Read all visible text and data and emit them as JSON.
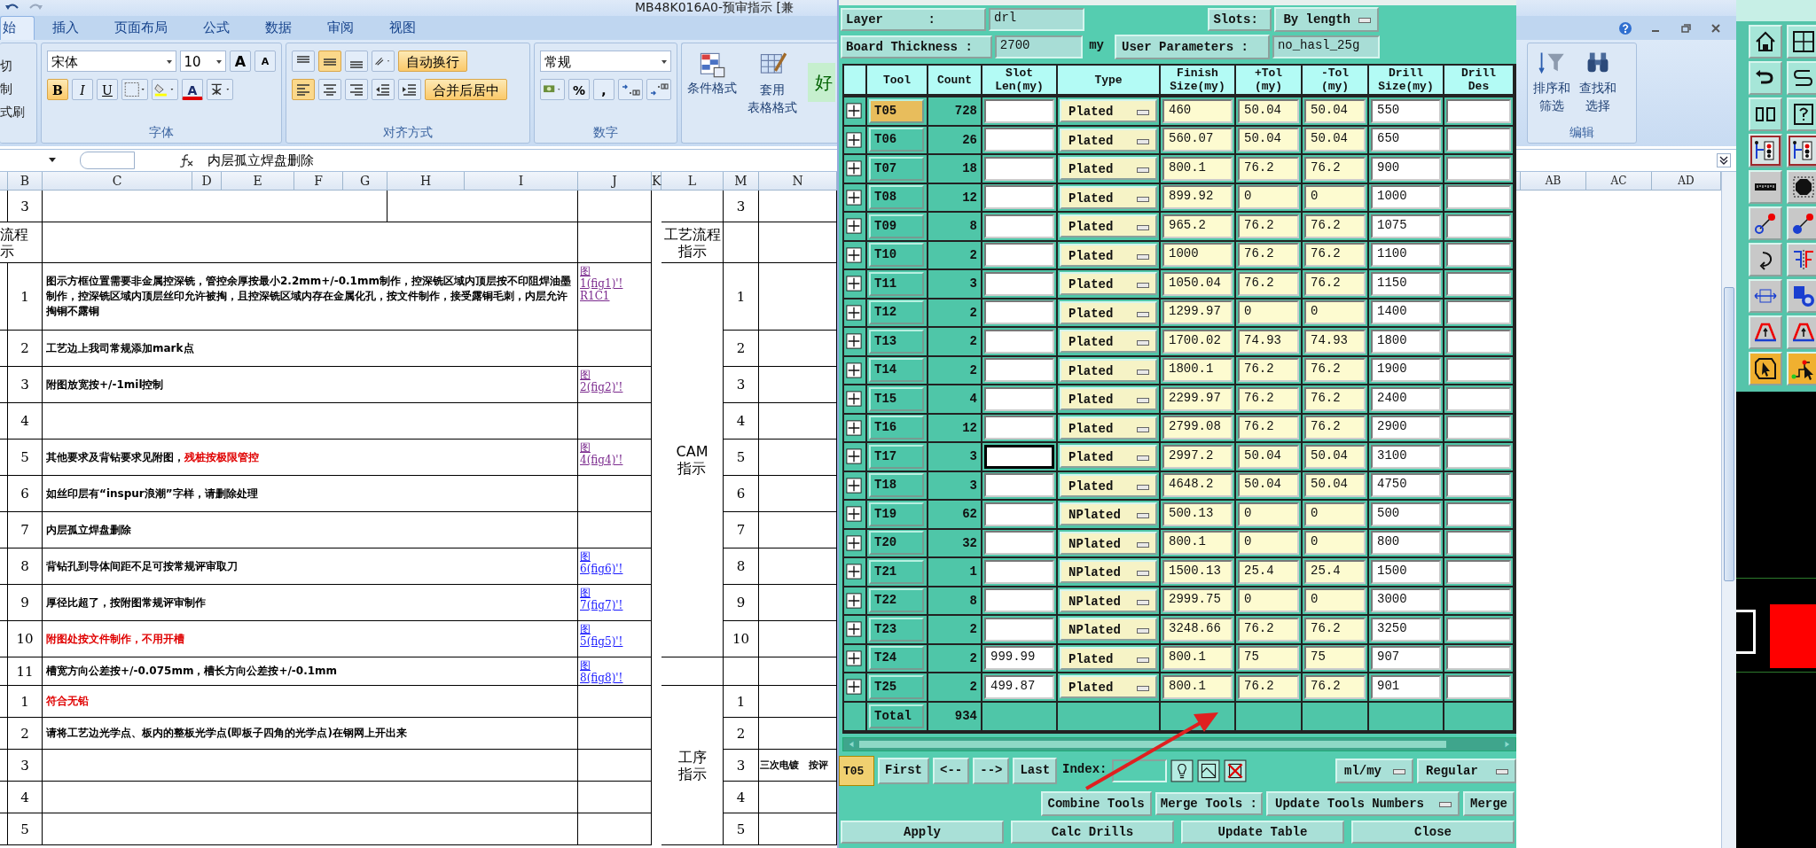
{
  "excel": {
    "title": "MB48K016A0-预审指示 [兼",
    "tabs": [
      {
        "label": "始",
        "selected": true
      },
      {
        "label": "插入",
        "selected": false
      },
      {
        "label": "页面布局",
        "selected": false
      },
      {
        "label": "公式",
        "selected": false
      },
      {
        "label": "数据",
        "selected": false
      },
      {
        "label": "审阅",
        "selected": false
      },
      {
        "label": "视图",
        "selected": false
      }
    ],
    "clipboard": [
      "切",
      "制",
      "式刷"
    ],
    "font_group": {
      "font": "宋体",
      "size": "10",
      "grow": "A",
      "shrink": "A",
      "bold": "B",
      "italic": "I",
      "underline": "U",
      "font_color_letter": "A",
      "label": "字体"
    },
    "align_group": {
      "wrap": "自动换行",
      "merge": "合并后居中",
      "label": "对齐方式"
    },
    "number_group": {
      "format": "常规",
      "percent": "%",
      "comma": ",",
      "label": "数字"
    },
    "styles_group": {
      "conditional": "条件格式",
      "table_style": [
        "套用",
        "表格格式"
      ],
      "good": "好"
    },
    "editing_group": {
      "sort": [
        "排序和",
        "筛选"
      ],
      "find": [
        "查找和",
        "选择"
      ],
      "label": "编辑"
    },
    "formula": "内层孤立焊盘删除",
    "columns": [
      "B",
      "C",
      "D",
      "E",
      "F",
      "G",
      "H",
      "I",
      "J",
      "K",
      "L",
      "M",
      "N"
    ],
    "far_columns": [
      "AB",
      "AC",
      "AD"
    ]
  },
  "sheet": {
    "top": {
      "b": "3",
      "m": "3"
    },
    "head": {
      "b": [
        "流程",
        "示"
      ],
      "l": [
        "工艺流程",
        "指示"
      ]
    },
    "groups": [
      {
        "label": [
          "CAM",
          "指示"
        ],
        "rows": [
          {
            "no": "1",
            "parts": [
              {
                "text": "图示方框位置需要非金属控深铣，管控余厚按最小2.2mm+/-0.1mm制作，控深铣区域内顶层按不印阻焊油墨制作，控深铣区域内顶层丝印允许被掏，且控深铣区域内存在金属化孔，按文件制作，接受露铜毛刺，内层允许掏铜不露铜",
                "alert": false
              }
            ],
            "link": {
              "text": "图\n1(fig1)'!\nR1C1",
              "visited": true
            },
            "m": "1"
          },
          {
            "no": "2",
            "parts": [
              {
                "text": "工艺边上我司常规添加mark点",
                "alert": false
              }
            ],
            "m": "2"
          },
          {
            "no": "3",
            "parts": [
              {
                "text": "附图放宽按+/-1mil控制",
                "alert": false
              }
            ],
            "link": {
              "text": "图\n2(fig2)'!",
              "visited": true
            },
            "m": "3"
          },
          {
            "no": "4",
            "m": "4"
          },
          {
            "no": "5",
            "parts": [
              {
                "text": "其他要求及背钻要求见附图，",
                "alert": false
              },
              {
                "text": "残桩按极限管控",
                "alert": true
              }
            ],
            "link": {
              "text": "图\n4(fig4)'!",
              "visited": true
            },
            "m": "5"
          },
          {
            "no": "6",
            "parts": [
              {
                "text": "如丝印层有“inspur浪潮”字样，请删除处理",
                "alert": false
              }
            ],
            "m": "6"
          },
          {
            "no": "7",
            "parts": [
              {
                "text": "内层孤立焊盘删除",
                "alert": false
              }
            ],
            "m": "7"
          },
          {
            "no": "8",
            "parts": [
              {
                "text": "背钻孔到导体间距不足可按常规评审取刀",
                "alert": false
              }
            ],
            "link": {
              "text": "图\n6(fig6)'!",
              "visited": false
            },
            "m": "8"
          },
          {
            "no": "9",
            "parts": [
              {
                "text": "厚径比超了，按附图常规评审制作",
                "alert": false
              }
            ],
            "link": {
              "text": "图\n7(fig7)'!",
              "visited": false
            },
            "m": "9"
          },
          {
            "no": "10",
            "parts": [
              {
                "text": "附图处按文件制作，不用开槽",
                "alert": true
              }
            ],
            "link": {
              "text": "图\n5(fig5)'!",
              "visited": false
            },
            "m": "10"
          }
        ]
      },
      {
        "rows": [
          {
            "no": "11",
            "parts": [
              {
                "text": "槽宽方向公差按+/-0.075mm，槽长方向公差按+/-0.1mm",
                "alert": false
              }
            ],
            "link": {
              "text": "图\n8(fig8)'!",
              "visited": false
            }
          }
        ]
      },
      {
        "label": [
          "工序",
          "指示"
        ],
        "rows": [
          {
            "no": "1",
            "parts": [
              {
                "text": "符合无铅",
                "alert": true
              }
            ],
            "m": "1"
          },
          {
            "no": "2",
            "parts": [
              {
                "text": "请将工艺边光学点、板内的整板光学点(即板子四角的光学点)在钢网上开出来",
                "alert": false
              }
            ],
            "m": "2"
          },
          {
            "no": "3",
            "m": "3",
            "n": "三次电镀　按评"
          },
          {
            "no": "4",
            "m": "4"
          },
          {
            "no": "5",
            "m": "5"
          }
        ]
      }
    ]
  },
  "dialog": {
    "layer_label": "Layer      :",
    "layer": "drl",
    "slots_label": "Slots:",
    "slots": "By length",
    "thickness_label": "Board Thickness :",
    "thickness": "2700",
    "thickness_unit": "my",
    "user_params": "User Parameters :",
    "user_params_value": "no_hasl_25g",
    "columns": [
      "Tool",
      "Count",
      "Slot\nLen(my)",
      "Type",
      "Finish\nSize(my)",
      "+Tol\n(my)",
      "-Tol\n(my)",
      "Drill\nSize(my)",
      "Drill\nDes"
    ],
    "rows": [
      {
        "tool": "T05",
        "count": "728",
        "type": "Plated",
        "finish": "460",
        "plus_tol": "50.04",
        "minus_tol": "50.04",
        "drill": "550",
        "selected": true,
        "focused": false
      },
      {
        "tool": "T06",
        "count": "26",
        "type": "Plated",
        "finish": "560.07",
        "plus_tol": "50.04",
        "minus_tol": "50.04",
        "drill": "650",
        "selected": false,
        "focused": false
      },
      {
        "tool": "T07",
        "count": "18",
        "type": "Plated",
        "finish": "800.1",
        "plus_tol": "76.2",
        "minus_tol": "76.2",
        "drill": "900",
        "selected": false,
        "focused": false
      },
      {
        "tool": "T08",
        "count": "12",
        "type": "Plated",
        "finish": "899.92",
        "plus_tol": "0",
        "minus_tol": "0",
        "drill": "1000",
        "selected": false,
        "focused": false
      },
      {
        "tool": "T09",
        "count": "8",
        "type": "Plated",
        "finish": "965.2",
        "plus_tol": "76.2",
        "minus_tol": "76.2",
        "drill": "1075",
        "selected": false,
        "focused": false
      },
      {
        "tool": "T10",
        "count": "2",
        "type": "Plated",
        "finish": "1000",
        "plus_tol": "76.2",
        "minus_tol": "76.2",
        "drill": "1100",
        "selected": false,
        "focused": false
      },
      {
        "tool": "T11",
        "count": "3",
        "type": "Plated",
        "finish": "1050.04",
        "plus_tol": "76.2",
        "minus_tol": "76.2",
        "drill": "1150",
        "selected": false,
        "focused": false
      },
      {
        "tool": "T12",
        "count": "2",
        "type": "Plated",
        "finish": "1299.97",
        "plus_tol": "0",
        "minus_tol": "0",
        "drill": "1400",
        "selected": false,
        "focused": false
      },
      {
        "tool": "T13",
        "count": "2",
        "type": "Plated",
        "finish": "1700.02",
        "plus_tol": "74.93",
        "minus_tol": "74.93",
        "drill": "1800",
        "selected": false,
        "focused": false
      },
      {
        "tool": "T14",
        "count": "2",
        "type": "Plated",
        "finish": "1800.1",
        "plus_tol": "76.2",
        "minus_tol": "76.2",
        "drill": "1900",
        "selected": false,
        "focused": false
      },
      {
        "tool": "T15",
        "count": "4",
        "type": "Plated",
        "finish": "2299.97",
        "plus_tol": "76.2",
        "minus_tol": "76.2",
        "drill": "2400",
        "selected": false,
        "focused": false
      },
      {
        "tool": "T16",
        "count": "12",
        "type": "Plated",
        "finish": "2799.08",
        "plus_tol": "76.2",
        "minus_tol": "76.2",
        "drill": "2900",
        "selected": false,
        "focused": false
      },
      {
        "tool": "T17",
        "count": "3",
        "type": "Plated",
        "finish": "2997.2",
        "plus_tol": "50.04",
        "minus_tol": "50.04",
        "drill": "3100",
        "selected": false,
        "focused": true
      },
      {
        "tool": "T18",
        "count": "3",
        "type": "Plated",
        "finish": "4648.2",
        "plus_tol": "50.04",
        "minus_tol": "50.04",
        "drill": "4750",
        "selected": false,
        "focused": false
      },
      {
        "tool": "T19",
        "count": "62",
        "type": "NPlated",
        "finish": "500.13",
        "plus_tol": "0",
        "minus_tol": "0",
        "drill": "500",
        "selected": false,
        "focused": false
      },
      {
        "tool": "T20",
        "count": "32",
        "type": "NPlated",
        "finish": "800.1",
        "plus_tol": "0",
        "minus_tol": "0",
        "drill": "800",
        "selected": false,
        "focused": false
      },
      {
        "tool": "T21",
        "count": "1",
        "type": "NPlated",
        "finish": "1500.13",
        "plus_tol": "25.4",
        "minus_tol": "25.4",
        "drill": "1500",
        "selected": false,
        "focused": false
      },
      {
        "tool": "T22",
        "count": "8",
        "type": "NPlated",
        "finish": "2999.75",
        "plus_tol": "0",
        "minus_tol": "0",
        "drill": "3000",
        "selected": false,
        "focused": false
      },
      {
        "tool": "T23",
        "count": "2",
        "type": "NPlated",
        "finish": "3248.66",
        "plus_tol": "76.2",
        "minus_tol": "76.2",
        "drill": "3250",
        "selected": false,
        "focused": false
      },
      {
        "tool": "T24",
        "count": "2",
        "slot": "999.99",
        "type": "Plated",
        "finish": "800.1",
        "plus_tol": "75",
        "minus_tol": "75",
        "drill": "907",
        "selected": false,
        "focused": false
      },
      {
        "tool": "T25",
        "count": "2",
        "slot": "499.87",
        "type": "Plated",
        "finish": "800.1",
        "plus_tol": "76.2",
        "minus_tol": "76.2",
        "drill": "901",
        "selected": false,
        "focused": false
      }
    ],
    "total_label": "Total",
    "total": "934",
    "current_tool": "T05",
    "nav": [
      "First",
      "<--",
      "-->",
      "Last"
    ],
    "index_label": "Index:",
    "units": "ml/my",
    "mode": "Regular",
    "combine": "Combine Tools",
    "merge_label": "Merge Tools :",
    "merge_mode": "Update Tools Numbers",
    "merge": "Merge",
    "actions": [
      "Apply",
      "Calc Drills",
      "Update Table",
      "Close"
    ]
  }
}
